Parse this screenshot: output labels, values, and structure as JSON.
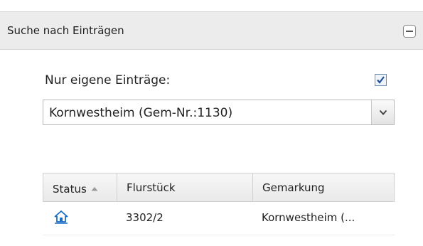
{
  "panel": {
    "title": "Suche nach Einträgen",
    "collapse_icon": "minus-icon"
  },
  "filter": {
    "own_entries_label": "Nur eigene Einträge:",
    "own_entries_checked": true
  },
  "municipality_select": {
    "selected": "Kornwestheim (Gem-Nr.:1130)",
    "trigger_icon": "chevron-down-icon"
  },
  "results_table": {
    "columns": [
      {
        "label": "Status",
        "sorted": "ascending"
      },
      {
        "label": "Flurstück"
      },
      {
        "label": "Gemarkung"
      }
    ],
    "rows": [
      {
        "status_icon": "home-icon",
        "flurstueck": "3302/2",
        "gemarkung": "Kornwestheim (..."
      }
    ]
  },
  "colors": {
    "header_bg": "#ececec",
    "icon_blue": "#1a6fc4",
    "border": "#d4d4d4"
  }
}
